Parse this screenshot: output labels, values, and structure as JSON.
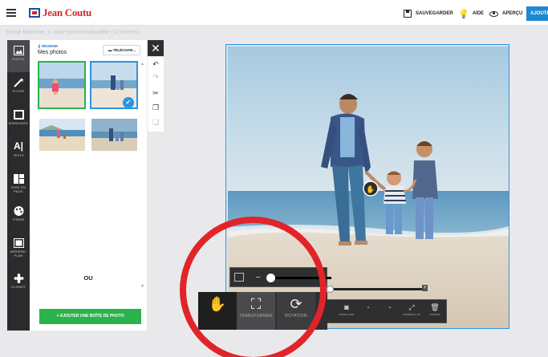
{
  "header": {
    "brand": "Jean Coutu",
    "save_label": "SAUVEGARDER",
    "help_label": "AIDE",
    "preview_label": "APERÇU",
    "add_label": "AJOUTER"
  },
  "subtitle": "Tasse blanche, 1 zone personnalisable (11 onces)",
  "rail": {
    "items": [
      {
        "label": "PHOTO",
        "icon": "image-icon"
      },
      {
        "label": "FILTRE",
        "icon": "magic-wand-icon"
      },
      {
        "label": "BORDURES",
        "icon": "border-icon"
      },
      {
        "label": "TEXTE",
        "icon": "text-icon"
      },
      {
        "label": "MISE EN PAGE",
        "icon": "layout-icon"
      },
      {
        "label": "THÈME",
        "icon": "palette-icon"
      },
      {
        "label": "ARRIÈRE-PLAN",
        "icon": "background-icon"
      },
      {
        "label": "CLIPART",
        "icon": "clipart-icon"
      }
    ]
  },
  "panel": {
    "back_label": "❮ REVENIR",
    "title": "Mes photos",
    "upload_label": "TÉLÉCHAR...",
    "or_label": "OU",
    "add_box_label": "+ AJOUTER UNE BOÎTE DE PHOTO"
  },
  "toolbar_bottom": {
    "transform_label": "TRANSFORMER",
    "rotation_label": "ROTATION",
    "extra_label": "...",
    "small_items": [
      "REMPLACER",
      "",
      "",
      "ARRIÈRE-PLAN",
      "RETIRER"
    ]
  },
  "colors": {
    "accent_blue": "#1e88d4",
    "green": "#2bb24c",
    "brand_red": "#d6262b",
    "highlight_ring": "#e1242a"
  }
}
